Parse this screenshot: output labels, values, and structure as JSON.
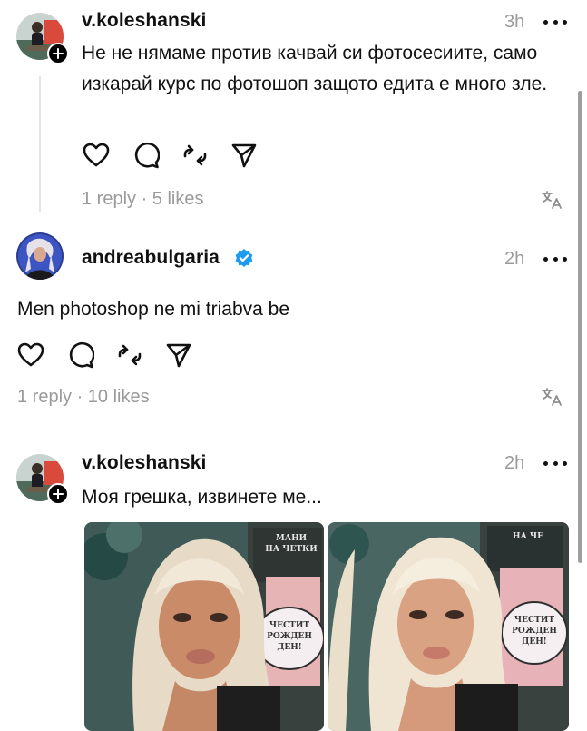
{
  "posts": [
    {
      "username": "v.koleshanski",
      "time": "3h",
      "text": "Не не нямаме против качвай си фотосесиите, само изкарай курс по фотошоп защото едита е много зле.",
      "stats": "1 reply · 5 likes"
    },
    {
      "username": "andreabulgaria",
      "time": "2h",
      "text": "Men photoshop ne mi triabva be",
      "stats": "1 reply · 10 likes"
    },
    {
      "username": "v.koleshanski",
      "time": "2h",
      "text": "Моя грешка, извинете ме..."
    }
  ],
  "photos": {
    "left_sign": "МАНИ\nНА ЧЕТКИ",
    "left_banner": "ЧЕСТИТ\nРОЖДЕН\nДЕН!",
    "right_sign": "НА ЧЕ",
    "right_banner": "ЧЕСТИТ\nРОЖДЕН\nДЕН!"
  },
  "icons": [
    "heart-icon",
    "comment-icon",
    "repost-icon",
    "share-icon",
    "translate-icon",
    "more-icon",
    "verified-icon",
    "plus-icon"
  ],
  "colors": {
    "verified": "#1d9bf0",
    "muted": "#9a9a9a"
  }
}
